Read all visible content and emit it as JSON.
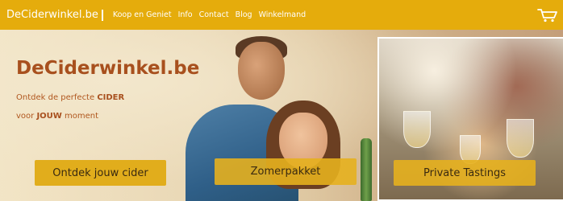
{
  "nav": {
    "brand": "DeCiderwinkel.be",
    "links": [
      "Koop en Geniet",
      "Info",
      "Contact",
      "Blog",
      "Winkelmand"
    ],
    "cart_icon": "shopping-cart-icon"
  },
  "hero": {
    "title": "DeCiderwinkel.be",
    "line1_pre": "Ontdek de perfecte ",
    "line1_bold": "CIDER",
    "line2_pre": "voor ",
    "line2_bold": "JOUW",
    "line2_post": " moment"
  },
  "buttons": {
    "discover": "Ontdek jouw cider",
    "summer": "Zomerpakket",
    "tastings": "Private Tastings"
  },
  "colors": {
    "nav_bg": "#e5ac0c",
    "accent": "#a8501e",
    "button_bg": "#e1ad1c"
  }
}
